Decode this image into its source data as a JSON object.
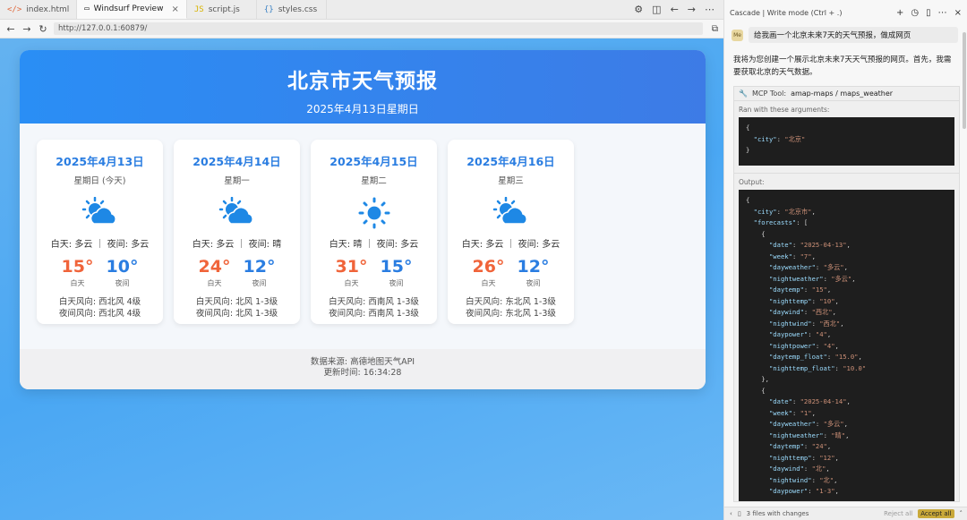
{
  "tabs": [
    {
      "icon": "</>",
      "label": "index.html",
      "color": "#e0683b"
    },
    {
      "icon": "▭",
      "label": "Windsurf Preview",
      "color": "#555555",
      "close": "×"
    },
    {
      "icon": "JS",
      "label": "script.js",
      "color": "#d8b400"
    },
    {
      "icon": "{}",
      "label": "styles.css",
      "color": "#3b82c4"
    }
  ],
  "url": "http://127.0.0.1:60879/",
  "page": {
    "title": "北京市天气预报",
    "subtitle": "2025年4月13日星期日",
    "days": [
      {
        "date": "2025年4月13日",
        "week": "星期日 (今天)",
        "icon": "partly-cloudy",
        "cond": "白天: 多云 ｜ 夜间: 多云",
        "hi": "15°",
        "lo": "10°",
        "hi_label": "白天",
        "lo_label": "夜间",
        "wind_day": "白天风向: 西北风 4级",
        "wind_night": "夜间风向: 西北风 4级"
      },
      {
        "date": "2025年4月14日",
        "week": "星期一",
        "icon": "partly-cloudy",
        "cond": "白天: 多云 ｜ 夜间: 晴",
        "hi": "24°",
        "lo": "12°",
        "hi_label": "白天",
        "lo_label": "夜间",
        "wind_day": "白天风向: 北风 1-3级",
        "wind_night": "夜间风向: 北风 1-3级"
      },
      {
        "date": "2025年4月15日",
        "week": "星期二",
        "icon": "sunny",
        "cond": "白天: 晴 ｜ 夜间: 多云",
        "hi": "31°",
        "lo": "15°",
        "hi_label": "白天",
        "lo_label": "夜间",
        "wind_day": "白天风向: 西南风 1-3级",
        "wind_night": "夜间风向: 西南风 1-3级"
      },
      {
        "date": "2025年4月16日",
        "week": "星期三",
        "icon": "partly-cloudy",
        "cond": "白天: 多云 ｜ 夜间: 多云",
        "hi": "26°",
        "lo": "12°",
        "hi_label": "白天",
        "lo_label": "夜间",
        "wind_day": "白天风向: 东北风 1-3级",
        "wind_night": "夜间风向: 东北风 1-3级"
      }
    ],
    "source": "数据来源: 高德地图天气API",
    "updated": "更新时间: 16:34:28"
  },
  "cascade": {
    "title": "Cascade | Write mode (Ctrl + .)",
    "user_avatar": "Me",
    "user_msg": "给我画一个北京未来7天的天气预报，做成网页",
    "reply": "我将为您创建一个展示北京未来7天天气预报的网页。首先，我需要获取北京的天气数据。",
    "tool_label": "MCP Tool:",
    "tool_name": "amap-maps / maps_weather",
    "args_label": "Ran with these arguments:",
    "output_label": "Output:",
    "footer_files": "3 files with changes",
    "reject": "Reject all",
    "accept": "Accept all"
  },
  "colors": {
    "accent": "#2a7de1",
    "hi_temp": "#f0643a",
    "hero": "#2a8ef5",
    "sun": "#1e88e5"
  }
}
